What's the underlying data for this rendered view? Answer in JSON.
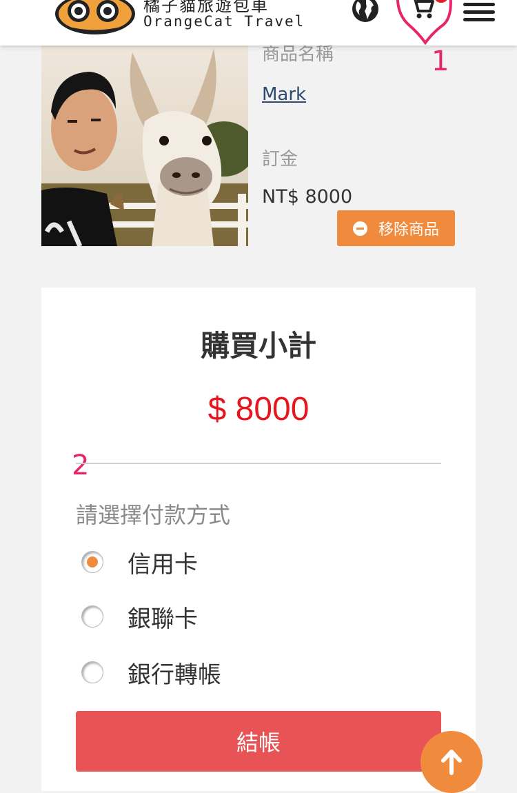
{
  "header": {
    "brand_zh": "橘子貓旅遊包車",
    "brand_en": "OrangeCat Travel",
    "logo_icon": "orange-cat-logo",
    "language_icon": "globe-icon",
    "cart_icon": "cart-icon",
    "menu_icon": "hamburger-menu-icon"
  },
  "annotations": {
    "first": "1",
    "second": "2"
  },
  "product": {
    "name_label": "商品名稱",
    "name": "Mark",
    "deposit_label": "訂金",
    "deposit_value": "NT$ 8000",
    "remove_label": "移除商品"
  },
  "summary": {
    "title": "購買小計",
    "total": "$ 8000",
    "payment_heading": "請選擇付款方式",
    "payment_options": [
      {
        "label": "信用卡",
        "selected": true
      },
      {
        "label": "銀聯卡",
        "selected": false
      },
      {
        "label": "銀行轉帳",
        "selected": false
      }
    ],
    "checkout_label": "結帳"
  },
  "colors": {
    "accent_orange": "#f08a3c",
    "checkout_red": "#e85456",
    "price_red": "#e5161d",
    "annotation_pink": "#e8256a",
    "link_blue": "#2d4a6e"
  }
}
